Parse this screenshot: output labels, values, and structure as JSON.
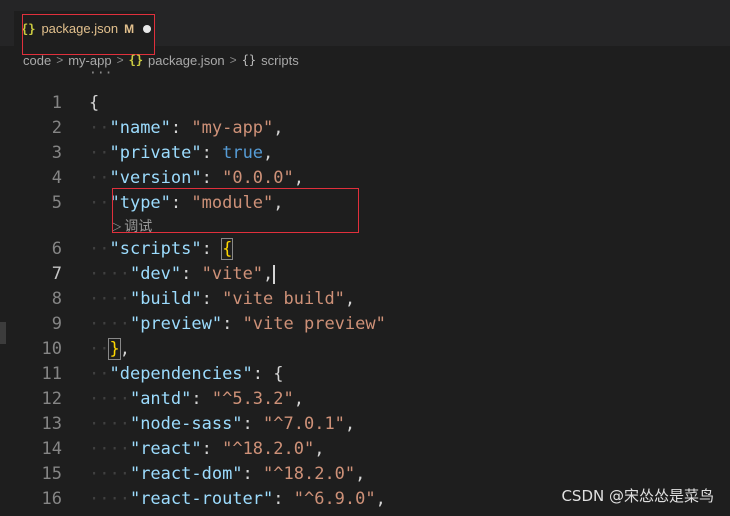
{
  "tab": {
    "icon": "{}",
    "label": "package.json",
    "status": "M"
  },
  "breadcrumb": [
    {
      "label": "code"
    },
    {
      "label": "my-app"
    },
    {
      "label": "package.json",
      "icon": "{}"
    },
    {
      "label": "scripts",
      "icon": "{}"
    }
  ],
  "ellipsis": "···",
  "codelens": {
    "icon": "▷",
    "label": "调试"
  },
  "lines": [
    {
      "n": "1",
      "tokens": [
        [
          "pun",
          "{"
        ]
      ]
    },
    {
      "n": "2",
      "tokens": [
        [
          "ws",
          "··"
        ],
        [
          "key",
          "\"name\""
        ],
        [
          "pun",
          ": "
        ],
        [
          "str",
          "\"my-app\""
        ],
        [
          "pun",
          ","
        ]
      ]
    },
    {
      "n": "3",
      "tokens": [
        [
          "ws",
          "··"
        ],
        [
          "key",
          "\"private\""
        ],
        [
          "pun",
          ": "
        ],
        [
          "kw",
          "true"
        ],
        [
          "pun",
          ","
        ]
      ]
    },
    {
      "n": "4",
      "tokens": [
        [
          "ws",
          "··"
        ],
        [
          "key",
          "\"version\""
        ],
        [
          "pun",
          ": "
        ],
        [
          "str",
          "\"0.0.0\""
        ],
        [
          "pun",
          ","
        ]
      ]
    },
    {
      "n": "5",
      "tokens": [
        [
          "ws",
          "··"
        ],
        [
          "key",
          "\"type\""
        ],
        [
          "pun",
          ": "
        ],
        [
          "str",
          "\"module\""
        ],
        [
          "pun",
          ","
        ]
      ]
    },
    {
      "n": "6",
      "tokens": [
        [
          "ws",
          "··"
        ],
        [
          "key",
          "\"scripts\""
        ],
        [
          "pun",
          ": "
        ],
        [
          "brk",
          "{"
        ]
      ]
    },
    {
      "n": "7",
      "active": true,
      "tokens": [
        [
          "ws",
          "····"
        ],
        [
          "key",
          "\"dev\""
        ],
        [
          "pun",
          ": "
        ],
        [
          "str",
          "\"vite\""
        ],
        [
          "pun",
          ","
        ],
        [
          "cursor",
          ""
        ]
      ]
    },
    {
      "n": "8",
      "tokens": [
        [
          "ws",
          "····"
        ],
        [
          "key",
          "\"build\""
        ],
        [
          "pun",
          ": "
        ],
        [
          "str",
          "\"vite build\""
        ],
        [
          "pun",
          ","
        ]
      ]
    },
    {
      "n": "9",
      "tokens": [
        [
          "ws",
          "····"
        ],
        [
          "key",
          "\"preview\""
        ],
        [
          "pun",
          ": "
        ],
        [
          "str",
          "\"vite preview\""
        ]
      ]
    },
    {
      "n": "10",
      "tokens": [
        [
          "ws",
          "··"
        ],
        [
          "brk",
          "}"
        ],
        [
          "pun",
          ","
        ]
      ]
    },
    {
      "n": "11",
      "tokens": [
        [
          "ws",
          "··"
        ],
        [
          "key",
          "\"dependencies\""
        ],
        [
          "pun",
          ": {"
        ]
      ]
    },
    {
      "n": "12",
      "tokens": [
        [
          "ws",
          "····"
        ],
        [
          "key",
          "\"antd\""
        ],
        [
          "pun",
          ": "
        ],
        [
          "str",
          "\"^5.3.2\""
        ],
        [
          "pun",
          ","
        ]
      ]
    },
    {
      "n": "13",
      "tokens": [
        [
          "ws",
          "····"
        ],
        [
          "key",
          "\"node-sass\""
        ],
        [
          "pun",
          ": "
        ],
        [
          "str",
          "\"^7.0.1\""
        ],
        [
          "pun",
          ","
        ]
      ]
    },
    {
      "n": "14",
      "tokens": [
        [
          "ws",
          "····"
        ],
        [
          "key",
          "\"react\""
        ],
        [
          "pun",
          ": "
        ],
        [
          "str",
          "\"^18.2.0\""
        ],
        [
          "pun",
          ","
        ]
      ]
    },
    {
      "n": "15",
      "tokens": [
        [
          "ws",
          "····"
        ],
        [
          "key",
          "\"react-dom\""
        ],
        [
          "pun",
          ": "
        ],
        [
          "str",
          "\"^18.2.0\""
        ],
        [
          "pun",
          ","
        ]
      ]
    },
    {
      "n": "16",
      "tokens": [
        [
          "ws",
          "····"
        ],
        [
          "key",
          "\"react-router\""
        ],
        [
          "pun",
          ": "
        ],
        [
          "str",
          "\"^6.9.0\""
        ],
        [
          "pun",
          ","
        ]
      ]
    }
  ],
  "watermark": "CSDN @宋怂怂是菜鸟",
  "colors": {
    "key": "#9cdcfe",
    "string": "#ce9178",
    "keyword": "#569cd6",
    "bracket": "#ffd700",
    "highlight": "#e0303c"
  }
}
